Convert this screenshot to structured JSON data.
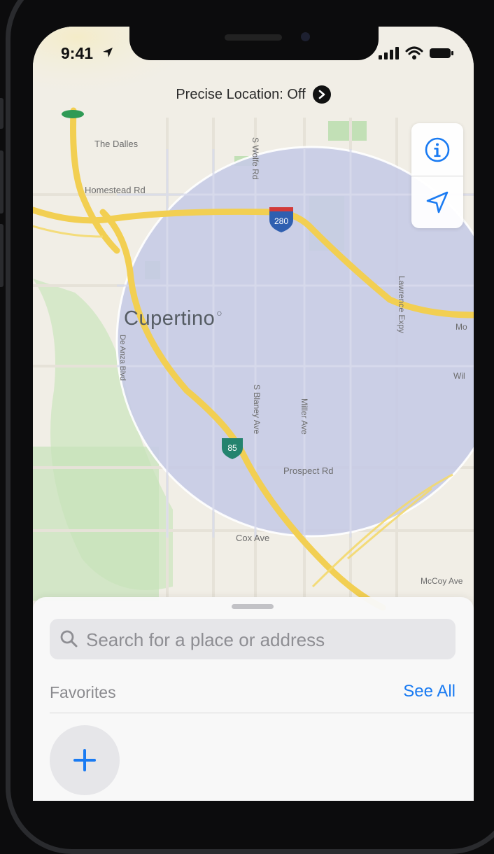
{
  "status_bar": {
    "time": "9:41",
    "icons": [
      "location-arrow-icon",
      "signal-icon",
      "wifi-icon",
      "battery-icon"
    ]
  },
  "banner": {
    "precise_location": "Precise Location: Off",
    "icon": "chevron-right-icon"
  },
  "map_controls": {
    "icons": [
      "info-icon",
      "location-icon"
    ],
    "accent": "#1a7bf2"
  },
  "map": {
    "city": "Cupertino",
    "streets": [
      "The Dalles",
      "Homestead Rd",
      "S Wolfe Rd",
      "Lawrence Expy",
      "S Blaney Ave",
      "Miller Ave",
      "Prospect Rd",
      "Cox Ave",
      "McCoy Ave",
      "Mo",
      "Wil",
      "De Anza Blvd"
    ],
    "highways": [
      "280",
      "85"
    ],
    "colors": {
      "road": "#f2cf52",
      "area": "#c5cae4",
      "park": "#bfe2b4"
    }
  },
  "sheet": {
    "search_placeholder": "Search for a place or address",
    "favorites_label": "Favorites",
    "see_all_label": "See All",
    "add_icon": "plus-icon"
  }
}
